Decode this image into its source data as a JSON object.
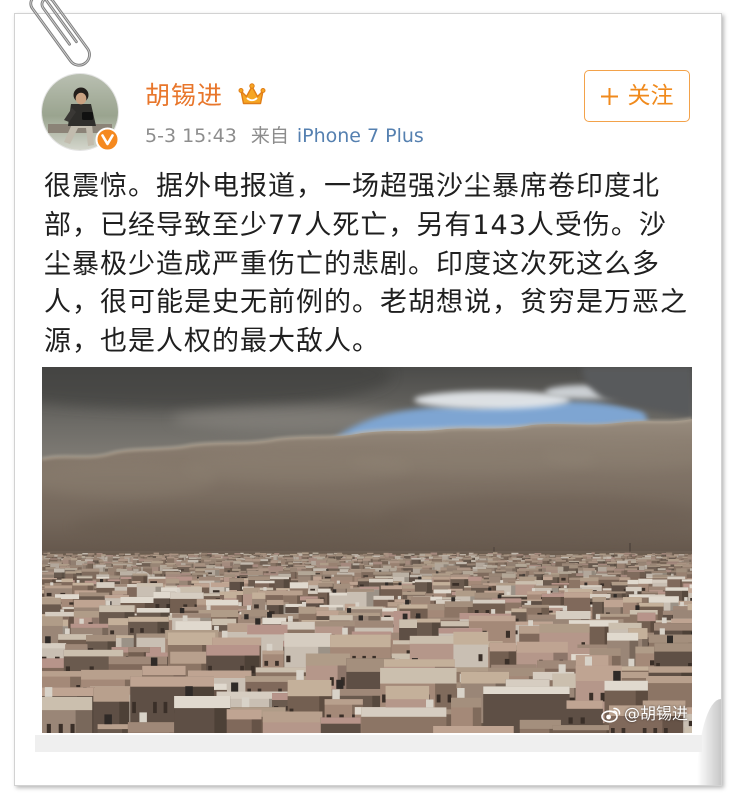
{
  "post": {
    "author": {
      "name": "胡锡进",
      "verified_icon": "verified-badge-icon",
      "vip_icon": "crown-icon"
    },
    "meta": {
      "time": "5-3 15:43",
      "source_prefix": "来自",
      "source": "iPhone 7 Plus"
    },
    "follow_button": {
      "icon": "plus-icon",
      "label": "关注"
    },
    "text_lines": [
      "很震惊。据外电报道，一场超强沙尘暴席卷印度北",
      "部，已经导致至少77人死亡，另有143人受伤。沙",
      "尘暴极少造成严重伤亡的悲剧。印度这次死这么多",
      "人，很可能是史无前例的。老胡想说，贫穷是万恶之",
      "源，也是人权的最大敌人。"
    ],
    "image": {
      "watermark_icon": "weibo-logo-icon",
      "watermark": "@胡锡进"
    }
  },
  "decor": {
    "paperclip_icon": "paperclip-icon"
  },
  "colors": {
    "author_name": "#e8762b",
    "follow_accent": "#f08a1c",
    "follow_border": "#f3a24a",
    "source_link": "#5580b0",
    "meta_text": "#8d8d8d",
    "post_text": "#1f1f1f",
    "verified_badge": "#f5891f",
    "vip_crown": "#f6a623"
  }
}
